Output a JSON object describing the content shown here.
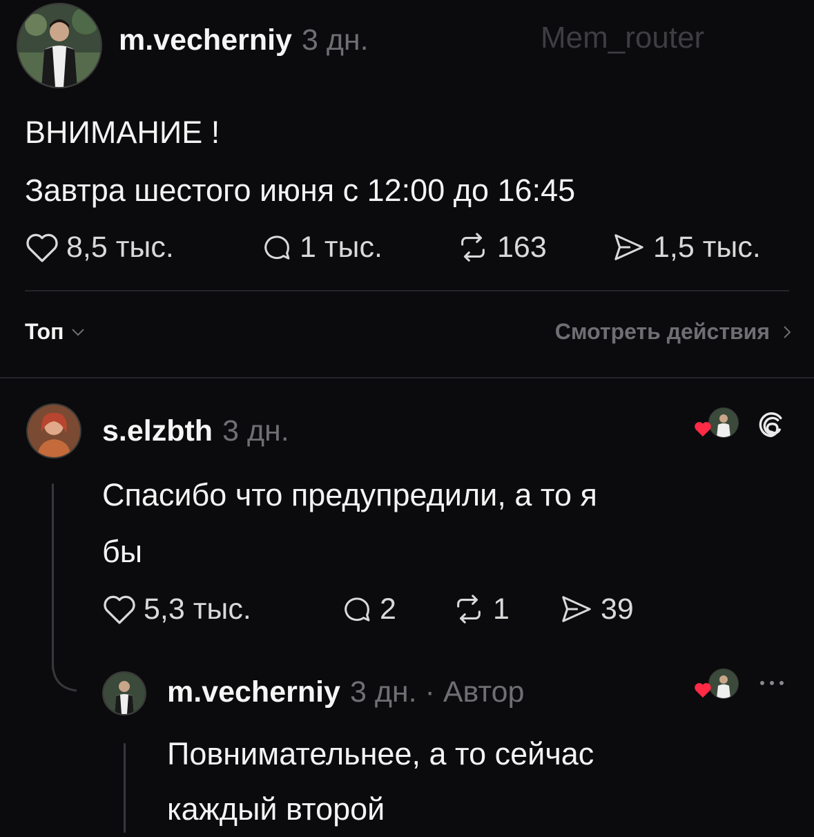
{
  "post": {
    "author": "m.vecherniy",
    "time": "3 дн.",
    "watermark": "Mem_router",
    "lines": [
      "ВНИМАНИЕ !",
      "Завтра шестого июня с 12:00 до 16:45"
    ],
    "stats": {
      "likes": "8,5 тыс.",
      "replies": "1 тыс.",
      "reposts": "163",
      "shares": "1,5 тыс."
    }
  },
  "toolbar": {
    "sort_label": "Топ",
    "activity_label": "Смотреть действия"
  },
  "comment": {
    "author": "s.elzbth",
    "time": "3 дн.",
    "lines": [
      "Спасибо что предупредили, а то я",
      "бы"
    ],
    "stats": {
      "likes": "5,3 тыс.",
      "replies": "2",
      "reposts": "1",
      "shares": "39"
    }
  },
  "reply": {
    "author": "m.vecherniy",
    "meta": "3 дн. · Автор",
    "lines": [
      "Повнимательнее, а то сейчас",
      "каждый второй"
    ]
  },
  "icons": {
    "like": "heart-icon",
    "reply": "comment-bubble-icon",
    "repost": "repost-icon",
    "share": "share-icon",
    "threads": "threads-logo-icon",
    "more": "more-dots-icon",
    "chevron_down": "chevron-down-icon",
    "chevron_right": "chevron-right-icon"
  },
  "colors": {
    "background": "#0b0b0d",
    "text": "#f3f3f3",
    "muted": "#6f6f73",
    "heart": "#ff2a45"
  }
}
